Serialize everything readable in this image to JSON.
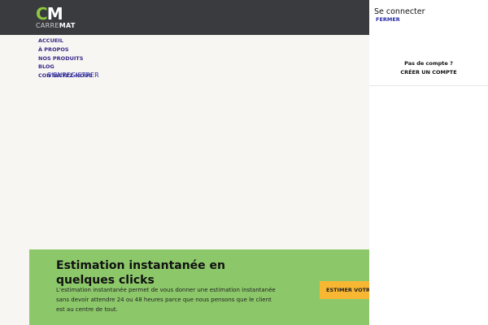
{
  "logo": {
    "mark_c": "C",
    "mark_m": "M",
    "word_light": "CARRE",
    "word_bold": "MAT"
  },
  "nav": {
    "items": [
      "ACCUEIL",
      "À PROPOS",
      "NOS PRODUITS",
      "BLOG",
      "CONTACTEZ-NOUS"
    ],
    "register": "S'ENREGISTRER"
  },
  "banner": {
    "title": "Estimation instantanée en quelques clicks",
    "text": "L'estimation instantanée permet de vous donner une estimation instantanée sans devoir attendre 24 ou 48 heures parce que nous pensons que le client est au centre de tout.",
    "button": "ESTIMER VOTRE"
  },
  "panel": {
    "title": "Se connecter",
    "close": "FERMER",
    "no_account": "Pas de compte ?",
    "create_account": "CRÉER UN COMPTE"
  },
  "colors": {
    "header_bg": "#393b3f",
    "page_bg": "#f8f6f2",
    "banner_bg": "#8cc86a",
    "button_bg": "#f7b733",
    "link": "#2b2fa6",
    "logo_accent": "#8dc63f"
  }
}
